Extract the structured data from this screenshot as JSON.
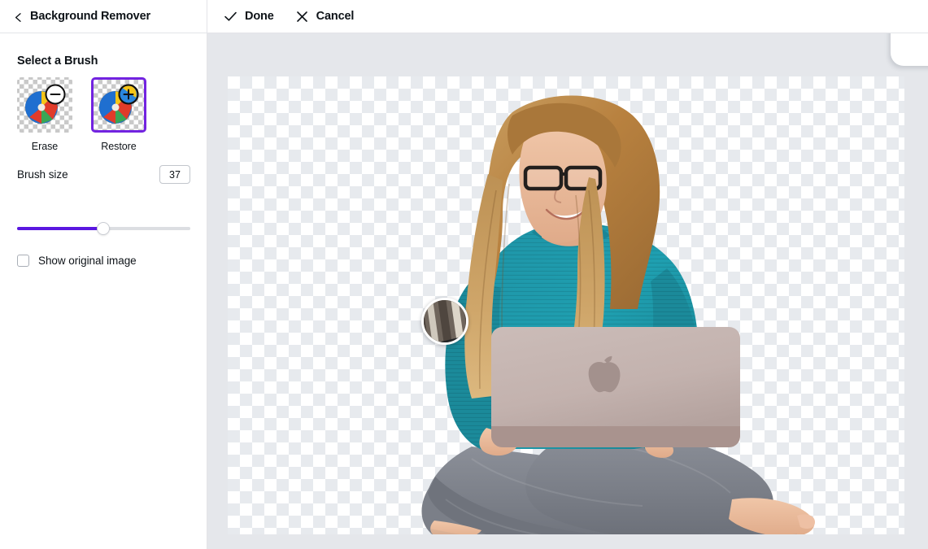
{
  "header": {
    "back_icon": "chevron-left-icon",
    "back_label": "Background Remover",
    "actions": [
      {
        "icon": "check-icon",
        "label": "Done"
      },
      {
        "icon": "close-x-icon",
        "label": "Cancel"
      }
    ]
  },
  "sidebar": {
    "panel_title": "Select a Brush",
    "brushes": [
      {
        "id": "erase",
        "label": "Erase",
        "badge": "minus-icon",
        "selected": false
      },
      {
        "id": "restore",
        "label": "Restore",
        "badge": "plus-icon",
        "selected": true
      }
    ],
    "brush_size": {
      "label": "Brush size",
      "value": "37",
      "min": 0,
      "max": 75,
      "fill_percent": 50
    },
    "show_original": {
      "label": "Show original image",
      "checked": false
    }
  },
  "canvas": {
    "transparency_pattern": "checkerboard",
    "brush_cursor": {
      "name": "brush-preview-bubble",
      "shows": "original-image-under-brush"
    },
    "subject": {
      "description": "Woman with glasses sitting cross-legged holding a laptop",
      "colors": {
        "sweater": "#1f94a6",
        "pants": "#7b7f88",
        "laptop": "#c0afab",
        "hair": "#b98b4e",
        "skin": "#e8b79b"
      }
    }
  },
  "colors": {
    "accent": "#5a17e0",
    "selection_border": "#7223e0",
    "text": "#0e1318",
    "divider": "#e3e4e8",
    "canvas_bg": "#e5e7eb"
  }
}
